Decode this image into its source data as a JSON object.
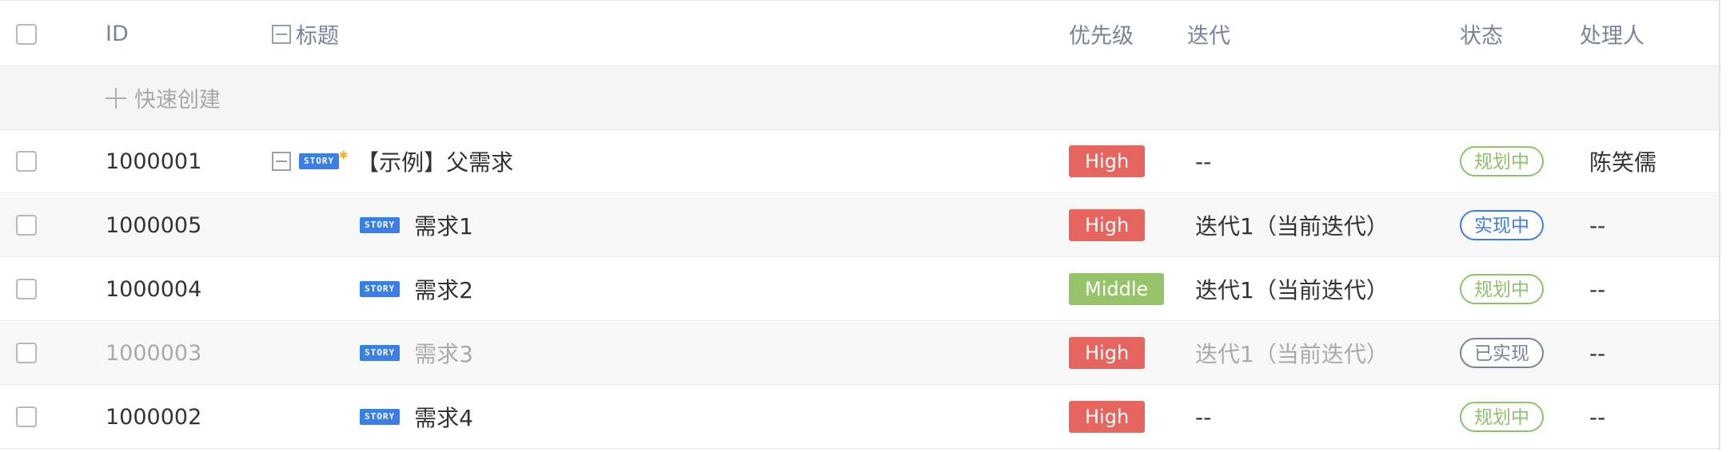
{
  "header": {
    "id": "ID",
    "title": "标题",
    "priority": "优先级",
    "iteration": "迭代",
    "status": "状态",
    "owner": "处理人"
  },
  "quick_create": "快速创建",
  "badge_text": "STORY",
  "colors": {
    "high": "#e6655f",
    "middle": "#97c36b",
    "story": "#3a7ee8",
    "status_plan": "#8cc26a",
    "status_doing": "#3a7ee8",
    "status_done": "#7b8496"
  },
  "rows": [
    {
      "id": "1000001",
      "title": "【示例】父需求",
      "priority": "High",
      "iteration": "--",
      "status": "规划中",
      "owner": "陈笑儒"
    },
    {
      "id": "1000005",
      "title": "需求1",
      "priority": "High",
      "iteration": "迭代1（当前迭代）",
      "status": "实现中",
      "owner": "--"
    },
    {
      "id": "1000004",
      "title": "需求2",
      "priority": "Middle",
      "iteration": "迭代1（当前迭代）",
      "status": "规划中",
      "owner": "--"
    },
    {
      "id": "1000003",
      "title": "需求3",
      "priority": "High",
      "iteration": "迭代1（当前迭代）",
      "status": "已实现",
      "owner": "--"
    },
    {
      "id": "1000002",
      "title": "需求4",
      "priority": "High",
      "iteration": "--",
      "status": "规划中",
      "owner": "--"
    }
  ]
}
